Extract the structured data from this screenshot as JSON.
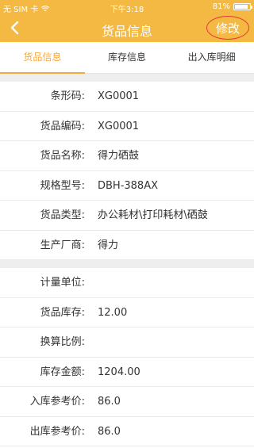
{
  "status_bar": {
    "carrier": "无 SIM 卡",
    "time": "下午3:18",
    "battery": "81%",
    "battery_level": 0.81
  },
  "nav": {
    "back_icon": "chevron-left-icon",
    "title": "货品信息",
    "edit_label": "修改"
  },
  "tabs": [
    {
      "label": "货品信息",
      "active": true
    },
    {
      "label": "库存信息",
      "active": false
    },
    {
      "label": "出入库明细",
      "active": false
    }
  ],
  "section1": [
    {
      "label": "条形码:",
      "value": "XG0001"
    },
    {
      "label": "货品编码:",
      "value": "XG0001"
    },
    {
      "label": "货品名称:",
      "value": "得力硒鼓"
    },
    {
      "label": "规格型号:",
      "value": "DBH-388AX"
    },
    {
      "label": "货品类型:",
      "value": "办公耗材\\打印耗材\\硒鼓"
    },
    {
      "label": "生产厂商:",
      "value": "得力"
    }
  ],
  "section2": [
    {
      "label": "计量单位:",
      "value": ""
    },
    {
      "label": "货品库存:",
      "value": "12.00"
    },
    {
      "label": "换算比例:",
      "value": ""
    },
    {
      "label": "库存金额:",
      "value": "1204.00"
    },
    {
      "label": "入库参考价:",
      "value": "86.0"
    },
    {
      "label": "出库参考价:",
      "value": "86.0"
    }
  ],
  "colors": {
    "header": "#f4b942",
    "accent": "#f4a93a",
    "edit_outline": "#e53935",
    "gap": "#eeeeee"
  }
}
